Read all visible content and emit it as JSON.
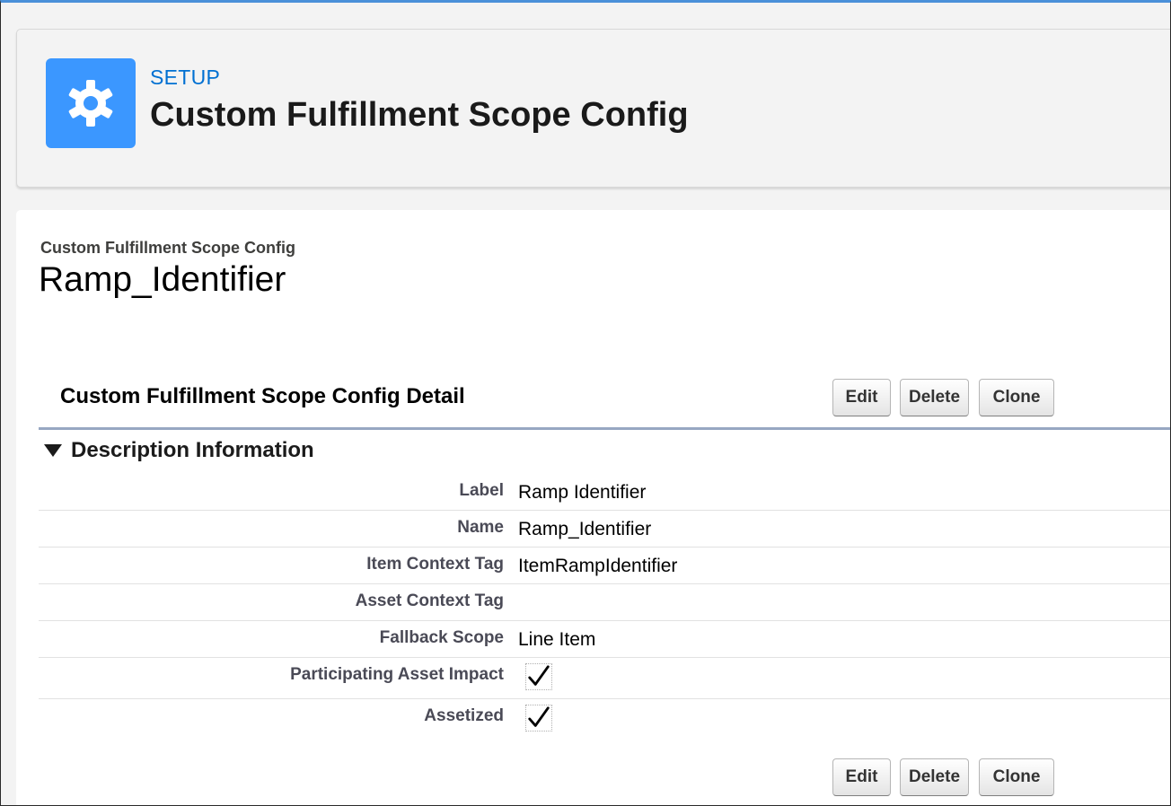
{
  "header": {
    "section": "SETUP",
    "title": "Custom Fulfillment Scope Config",
    "icon": "gear-icon",
    "icon_bg": "#3b97ff"
  },
  "record": {
    "type_label": "Custom Fulfillment Scope Config",
    "name": "Ramp_Identifier"
  },
  "detail": {
    "title": "Custom Fulfillment Scope Config Detail",
    "buttons": {
      "edit": "Edit",
      "delete": "Delete",
      "clone": "Clone"
    },
    "section_title": "Description Information",
    "fields": [
      {
        "label": "Label",
        "value": "Ramp Identifier"
      },
      {
        "label": "Name",
        "value": "Ramp_Identifier"
      },
      {
        "label": "Item Context Tag",
        "value": "ItemRampIdentifier"
      },
      {
        "label": "Asset Context Tag",
        "value": ""
      },
      {
        "label": "Fallback Scope",
        "value": "Line Item"
      },
      {
        "label": "Participating Asset Impact",
        "checked": true
      },
      {
        "label": "Assetized",
        "checked": true
      }
    ]
  }
}
